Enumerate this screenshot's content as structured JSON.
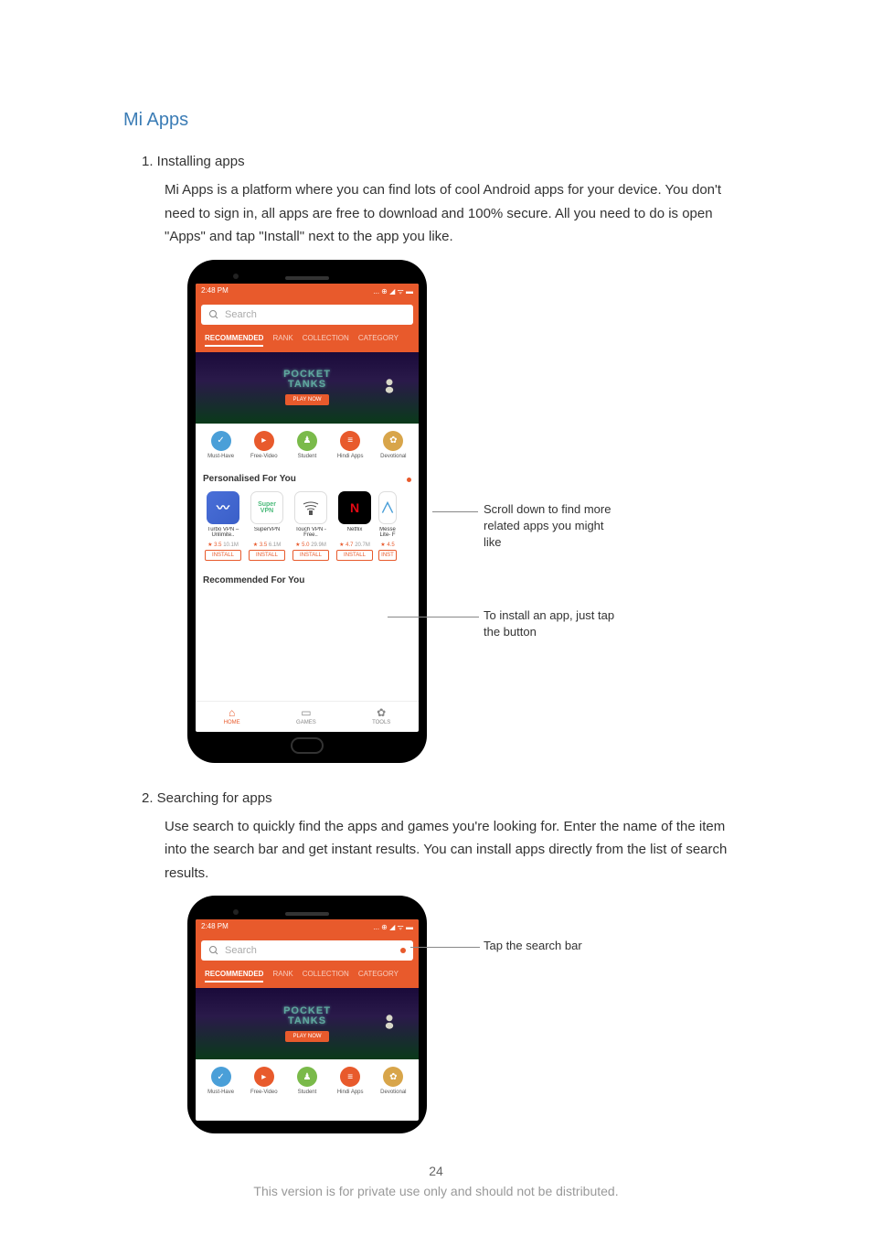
{
  "title": "Mi Apps",
  "section1": {
    "num": "1. Installing apps",
    "body": "Mi Apps is a platform where you can find lots of cool Android apps for your device. You don't need to sign in, all apps are free to download and 100% secure. All you need to do is open \"Apps\" and tap \"Install\" next to the app you like."
  },
  "section2": {
    "num": "2. Searching for apps",
    "body": "Use search to quickly find the apps and games you're looking for. Enter the name of the item into the search bar and get instant results. You can install apps directly from the list of search results."
  },
  "phone": {
    "time": "2:48 PM",
    "status_icons": "... ⊕ ◢ ᯤ ▬",
    "search_placeholder": "Search",
    "tabs": [
      {
        "label": "RECOMMENDED",
        "active": true
      },
      {
        "label": "RANK",
        "active": false
      },
      {
        "label": "COLLECTION",
        "active": false
      },
      {
        "label": "CATEGORY",
        "active": false
      }
    ],
    "banner": {
      "line1": "POCKET",
      "line2": "TANKS",
      "button": "PLAY NOW"
    },
    "categories": [
      {
        "label": "Must-Have",
        "glyph": "✓"
      },
      {
        "label": "Free-Video",
        "glyph": "▸"
      },
      {
        "label": "Student",
        "glyph": "♟"
      },
      {
        "label": "Hindi Apps",
        "glyph": "≡"
      },
      {
        "label": "Devotional",
        "glyph": "✿"
      }
    ],
    "personalised_title": "Personalised For You",
    "apps": [
      {
        "name": "Turbo VPN – Unlimite..",
        "rating": "★ 3.5",
        "count": "10.1M",
        "btn": "INSTALL"
      },
      {
        "name": "SuperVPN",
        "rating": "★ 3.5",
        "count": "6.1M",
        "btn": "INSTALL"
      },
      {
        "name": "Touch VPN -Free..",
        "rating": "★ 5.0",
        "count": "29.9M",
        "btn": "INSTALL"
      },
      {
        "name": "Netflix",
        "rating": "★ 4.7",
        "count": "20.7M",
        "btn": "INSTALL"
      },
      {
        "name": "Messe Lite- F",
        "rating": "★ 4.5",
        "count": "",
        "btn": "INST"
      }
    ],
    "recommended_title": "Recommended For You",
    "nav": [
      {
        "label": "HOME",
        "glyph": "⌂",
        "active": true
      },
      {
        "label": "GAMES",
        "glyph": "▭",
        "active": false
      },
      {
        "label": "TOOLS",
        "glyph": "✿",
        "active": false
      }
    ]
  },
  "callouts": {
    "scroll": "Scroll down to find more related apps you might like",
    "install": "To install an app, just tap the button",
    "search": "Tap the search bar"
  },
  "footer": {
    "page": "24",
    "disclaimer": "This version is for private use only and should not be distributed."
  }
}
